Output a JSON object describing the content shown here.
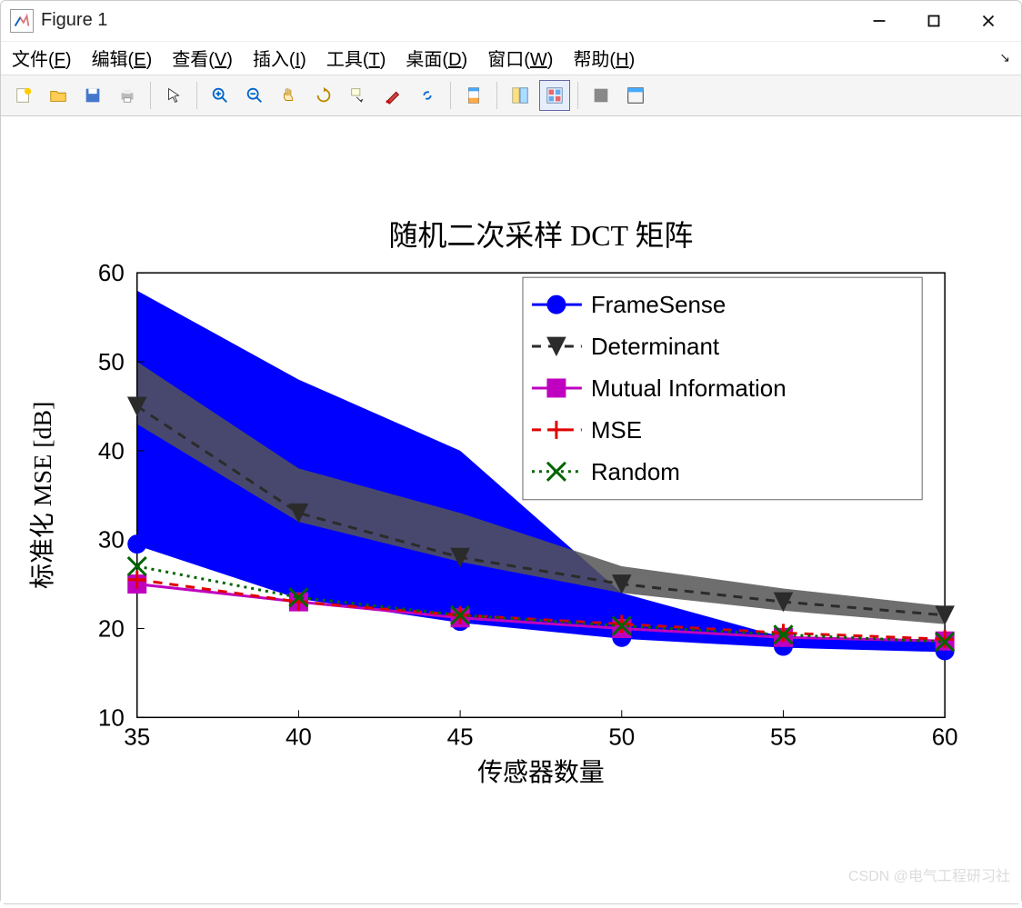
{
  "window": {
    "title": "Figure 1"
  },
  "menu": {
    "file": "文件(F)",
    "edit": "编辑(E)",
    "view": "查看(V)",
    "insert": "插入(I)",
    "tools": "工具(T)",
    "desktop": "桌面(D)",
    "window": "窗口(W)",
    "help": "帮助(H)"
  },
  "watermark": "CSDN @电气工程研习社",
  "chart_data": {
    "type": "line",
    "title": "随机二次采样 DCT 矩阵",
    "xlabel": "传感器数量",
    "ylabel": "标准化 MSE [dB]",
    "xticks": [
      35,
      40,
      45,
      50,
      55,
      60
    ],
    "yticks": [
      10,
      20,
      30,
      40,
      50,
      60
    ],
    "xlim": [
      35,
      60
    ],
    "ylim": [
      10,
      60
    ],
    "fill_region": {
      "color": "#0000ff",
      "upper": [
        58,
        48,
        40,
        24,
        19,
        18.5
      ],
      "lower": [
        29.5,
        23.5,
        20.8,
        19,
        18,
        17.5
      ]
    },
    "band_region": {
      "color": "#555555",
      "upper": [
        50,
        38,
        33,
        27,
        24.5,
        22.5
      ],
      "lower": [
        43,
        32,
        27.5,
        24,
        22,
        20.5
      ]
    },
    "series": [
      {
        "name": "FrameSense",
        "color": "#0000ff",
        "marker": "circle",
        "dash": "solid",
        "values": [
          29.5,
          23.5,
          20.8,
          19,
          18,
          17.5
        ]
      },
      {
        "name": "Determinant",
        "color": "#2b2b2b",
        "marker": "triangle",
        "dash": "dashed",
        "values": [
          45,
          33,
          28,
          25,
          23,
          21.5
        ]
      },
      {
        "name": "Mutual Information",
        "color": "#c000c0",
        "marker": "square",
        "dash": "solid",
        "values": [
          25,
          23,
          21.2,
          20,
          19,
          18.6
        ]
      },
      {
        "name": "MSE",
        "color": "#e00000",
        "marker": "plus",
        "dash": "dashed",
        "values": [
          25.5,
          23,
          21.5,
          20.5,
          19.5,
          18.8
        ]
      },
      {
        "name": "Random",
        "color": "#006400",
        "marker": "x",
        "dash": "dotted",
        "values": [
          27,
          23.5,
          21.5,
          20.3,
          19.3,
          18.5
        ]
      }
    ],
    "legend_position": "upper-right-inside"
  }
}
